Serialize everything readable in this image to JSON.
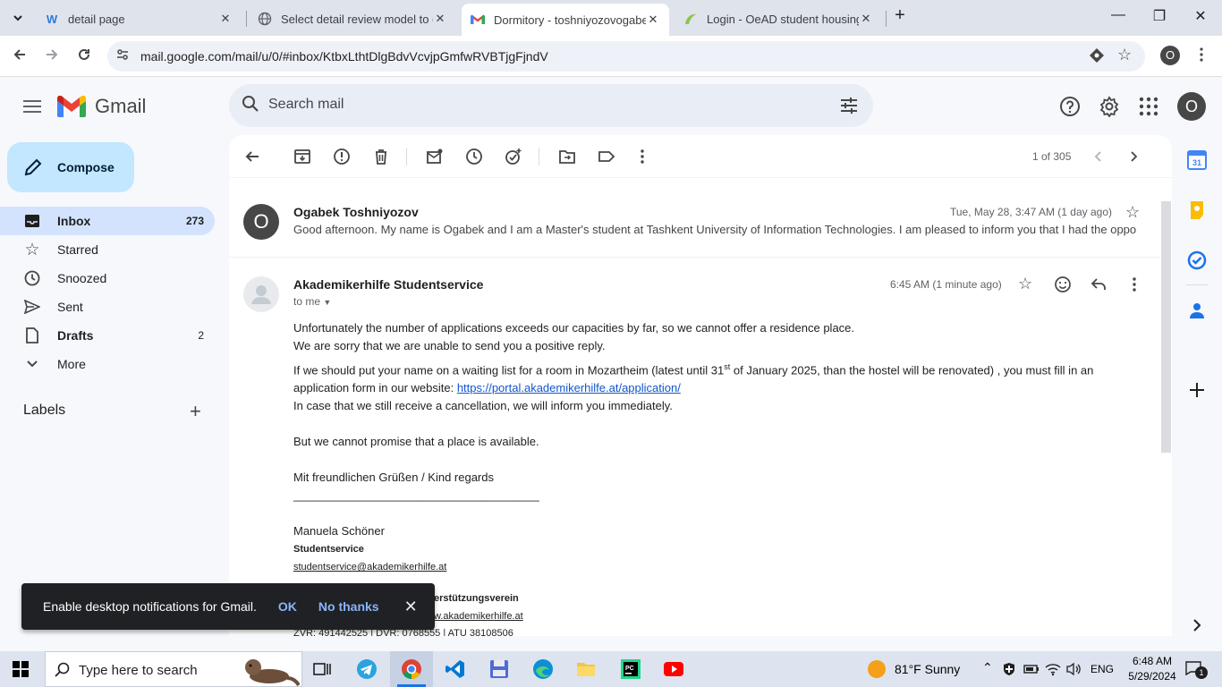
{
  "browser": {
    "tabs": [
      {
        "title": "detail page",
        "icon": "w-icon",
        "active": false
      },
      {
        "title": "Select detail review model to ch",
        "icon": "globe-icon",
        "active": false
      },
      {
        "title": "Dormitory - toshniyozovogabek",
        "icon": "gmail-icon",
        "active": true
      },
      {
        "title": "Login - OeAD student housing",
        "icon": "oead-icon",
        "active": false
      }
    ],
    "url": "mail.google.com/mail/u/0/#inbox/KtbxLthtDlgBdvVcvjpGmfwRVBTjgFjndV",
    "profile_initial": "O"
  },
  "gmail": {
    "brand": "Gmail",
    "search_placeholder": "Search mail",
    "avatar_initial": "O",
    "compose_label": "Compose",
    "nav": [
      {
        "label": "Inbox",
        "count": "273",
        "icon": "inbox-icon",
        "active": true
      },
      {
        "label": "Starred",
        "count": "",
        "icon": "star-icon",
        "active": false
      },
      {
        "label": "Snoozed",
        "count": "",
        "icon": "clock-icon",
        "active": false
      },
      {
        "label": "Sent",
        "count": "",
        "icon": "send-icon",
        "active": false
      },
      {
        "label": "Drafts",
        "count": "2",
        "icon": "draft-icon",
        "active": false
      },
      {
        "label": "More",
        "count": "",
        "icon": "chevron-down-icon",
        "active": false
      }
    ],
    "labels_header": "Labels",
    "pager": "1 of 305"
  },
  "thread": {
    "msg1": {
      "sender": "Ogabek Toshniyozov",
      "avatar": "O",
      "date": "Tue, May 28, 3:47 AM (1 day ago)",
      "snippet": "Good afternoon. My name is Ogabek and I am a Master's student at Tashkent University of Information Technologies. I am pleased to inform you that I had the oppo"
    },
    "msg2": {
      "sender": "Akademikerhilfe Studentservice",
      "date": "6:45 AM (1 minute ago)",
      "to": "to me",
      "line1": "Unfortunately the number of applications exceeds our capacities by far, so we cannot offer a residence place.",
      "line2": "We are sorry that we are unable to send you a positive reply.",
      "line3a": "If we should put your name on a waiting list for a room in Mozartheim (latest until 31",
      "line3sup": "st",
      "line3b": " of January 2025, than the hostel will be renovated) , you must fill in an application form in our website: ",
      "link": "https://portal.akademikerhilfe.at/application/",
      "line4": "In case that we still receive a cancellation, we will inform you immediately.",
      "line5": "But we cannot promise that a place is available.",
      "regards": "Mit freundlichen Grüßen / Kind regards",
      "rule": "______________________________________",
      "sig_name": "Manuela Schöner",
      "sig_title": "Studentservice",
      "sig_email": "studentservice@akademikerhilfe.at",
      "sig_org_partial": "erstützungsverein",
      "sig_web_partial": "w.akademikerhilfe.at",
      "sig_footer_partial": "ZVR: 491442525 | DVR: 0768555 | ATU 38108506"
    }
  },
  "snackbar": {
    "message": "Enable desktop notifications for Gmail.",
    "ok": "OK",
    "no_thanks": "No thanks"
  },
  "taskbar": {
    "search_placeholder": "Type here to search",
    "weather": "81°F  Sunny",
    "lang": "ENG",
    "time": "6:48 AM",
    "date": "5/29/2024",
    "notif_count": "1"
  },
  "colors": {
    "accent": "#0b57d0",
    "compose_bg": "#c2e7ff",
    "active_nav": "#d3e3fd",
    "link": "#1155cc"
  }
}
